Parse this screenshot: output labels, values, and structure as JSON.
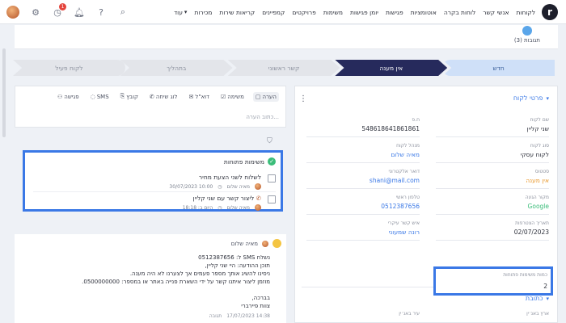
{
  "topbar": {
    "logo": "r",
    "nav": [
      "לקוחות",
      "אנשי קשר",
      "לוחות בקרה",
      "אוטומציות",
      "פגישות",
      "יומן פגישות",
      "משימות",
      "פרויקטים",
      "קמפיינים",
      "קריאות שירות",
      "מכירות"
    ],
    "more_label": "עוד",
    "notification_count": "1"
  },
  "header": {
    "updates_label": "תגובות (3)"
  },
  "pipeline": [
    "חדש",
    "אין מענה",
    "קשר ראשוני",
    "בתהליך",
    "לקוח פעיל"
  ],
  "notes": {
    "tabs": [
      "הערה",
      "משימה",
      "דוא\"ל",
      "לוג שיחה",
      "קובץ",
      "SMS",
      "פגישה"
    ],
    "placeholder": "כתוב הערה..."
  },
  "tasks": {
    "title": "משימות פתוחות",
    "items": [
      {
        "name": "לשלוח לשני הצעת מחיר",
        "owner": "מאיה שלום",
        "when": "30/07/2023 10:00"
      },
      {
        "name": "ליצור קשר עם שני קליין",
        "owner": "מאיה שלום",
        "when": "היום ב: 18:18"
      }
    ]
  },
  "sms": {
    "author": "מאיה שלום",
    "lines": [
      "נשלח SMS ל: 0512387656",
      "תוכן ההודעה: היי  שני קליין,",
      "ניסינו להשיג אותך מספר פעמים אך לצערנו לא היה מענה.",
      "מוזמן ליצור איתנו קשר על ידי השארת פנייה באתר או במספר: 0500000000.",
      "",
      "בברכה,",
      "צוות פיירברי"
    ],
    "reply": "תגובה",
    "time": "17/07/2023 14:38"
  },
  "details": {
    "title": "פרטי לקוח",
    "fields": {
      "name": {
        "label": "שם לקוח",
        "value": "שני קליין"
      },
      "id": {
        "label": "ח.פ",
        "value": "548618641861861"
      },
      "type": {
        "label": "סוג לקוח",
        "value": "לקוח עסקי"
      },
      "manager": {
        "label": "מנהל לקוח",
        "value": "מאיה שלום"
      },
      "status": {
        "label": "סטטוס",
        "value": "אין מענה"
      },
      "email": {
        "label": "דואר אלקטרוני",
        "value": "shani@mail.com"
      },
      "source": {
        "label": "מקור הגעה",
        "value": "Google"
      },
      "phone": {
        "label": "טלפון ראשי",
        "value": "0512387656"
      },
      "created": {
        "label": "תאריך הצטרפות",
        "value": "02/07/2023"
      },
      "contact": {
        "label": "איש קשר עיקרי",
        "value": "רונה שמעוני"
      },
      "open_tasks": {
        "label": "כמות משימות פתוחות",
        "value": "2"
      }
    },
    "address_title": "כתובת",
    "country_label": "ארץ באנ׳ין",
    "city_label": "עיר באנ׳ין"
  },
  "colors": {
    "accent": "#3a78e6",
    "pipeline_active": "#262a5c",
    "highlight": "#3a78e6"
  }
}
